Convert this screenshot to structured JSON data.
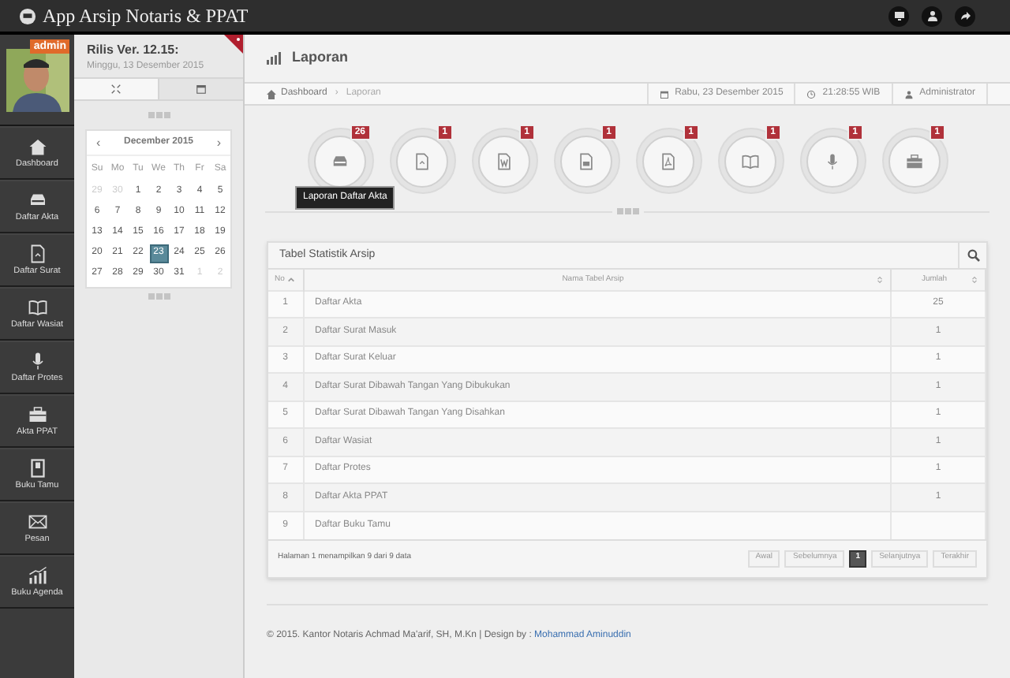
{
  "app_title": "App Arsip Notaris & PPAT",
  "profile": {
    "badge": "admin"
  },
  "nav": [
    {
      "label": "Dashboard"
    },
    {
      "label": "Daftar Akta"
    },
    {
      "label": "Daftar Surat"
    },
    {
      "label": "Daftar Wasiat"
    },
    {
      "label": "Daftar Protes"
    },
    {
      "label": "Akta PPAT"
    },
    {
      "label": "Buku Tamu"
    },
    {
      "label": "Pesan"
    },
    {
      "label": "Buku Agenda"
    }
  ],
  "release": {
    "title": "Rilis Ver. 12.15:",
    "date": "Minggu, 13 Desember 2015"
  },
  "panel_tabs": [
    {
      "selected": false
    },
    {
      "selected": true
    }
  ],
  "calendar": {
    "prev": "‹",
    "next": "›",
    "month": "December 2015",
    "weekdays": [
      "Su",
      "Mo",
      "Tu",
      "We",
      "Th",
      "Fr",
      "Sa"
    ],
    "days": [
      {
        "d": "29",
        "muted": true,
        "selected": false
      },
      {
        "d": "30",
        "muted": true,
        "selected": false
      },
      {
        "d": "1",
        "muted": false,
        "selected": false
      },
      {
        "d": "2",
        "muted": false,
        "selected": false
      },
      {
        "d": "3",
        "muted": false,
        "selected": false
      },
      {
        "d": "4",
        "muted": false,
        "selected": false
      },
      {
        "d": "5",
        "muted": false,
        "selected": false
      },
      {
        "d": "6",
        "muted": false,
        "selected": false
      },
      {
        "d": "7",
        "muted": false,
        "selected": false
      },
      {
        "d": "8",
        "muted": false,
        "selected": false
      },
      {
        "d": "9",
        "muted": false,
        "selected": false
      },
      {
        "d": "10",
        "muted": false,
        "selected": false
      },
      {
        "d": "11",
        "muted": false,
        "selected": false
      },
      {
        "d": "12",
        "muted": false,
        "selected": false
      },
      {
        "d": "13",
        "muted": false,
        "selected": false
      },
      {
        "d": "14",
        "muted": false,
        "selected": false
      },
      {
        "d": "15",
        "muted": false,
        "selected": false
      },
      {
        "d": "16",
        "muted": false,
        "selected": false
      },
      {
        "d": "17",
        "muted": false,
        "selected": false
      },
      {
        "d": "18",
        "muted": false,
        "selected": false
      },
      {
        "d": "19",
        "muted": false,
        "selected": false
      },
      {
        "d": "20",
        "muted": false,
        "selected": false
      },
      {
        "d": "21",
        "muted": false,
        "selected": false
      },
      {
        "d": "22",
        "muted": false,
        "selected": false
      },
      {
        "d": "23",
        "muted": false,
        "selected": true
      },
      {
        "d": "24",
        "muted": false,
        "selected": false
      },
      {
        "d": "25",
        "muted": false,
        "selected": false
      },
      {
        "d": "26",
        "muted": false,
        "selected": false
      },
      {
        "d": "27",
        "muted": false,
        "selected": false
      },
      {
        "d": "28",
        "muted": false,
        "selected": false
      },
      {
        "d": "29",
        "muted": false,
        "selected": false
      },
      {
        "d": "30",
        "muted": false,
        "selected": false
      },
      {
        "d": "31",
        "muted": false,
        "selected": false
      },
      {
        "d": "1",
        "muted": true,
        "selected": false
      },
      {
        "d": "2",
        "muted": true,
        "selected": false
      }
    ]
  },
  "page_title": "Laporan",
  "breadcrumb": [
    "Dashboard",
    "Laporan"
  ],
  "breadcrumb_separator": "›",
  "info_bar": [
    "Rabu, 23 Desember 2015",
    "21:28:55 WIB",
    "Administrator"
  ],
  "shortcuts": [
    {
      "count": "26"
    },
    {
      "count": "1"
    },
    {
      "count": "1"
    },
    {
      "count": "1"
    },
    {
      "count": "1"
    },
    {
      "count": "1"
    },
    {
      "count": "1"
    },
    {
      "count": "1"
    }
  ],
  "tooltip": "Laporan Daftar Akta",
  "table": {
    "title": "Tabel Statistik Arsip",
    "columns": [
      "No",
      "Nama Tabel Arsip",
      "Jumlah"
    ],
    "rows": [
      [
        "1",
        "Daftar Akta",
        "25"
      ],
      [
        "2",
        "Daftar Surat Masuk",
        "1"
      ],
      [
        "3",
        "Daftar Surat Keluar",
        "1"
      ],
      [
        "4",
        "Daftar Surat Dibawah Tangan Yang Dibukukan",
        "1"
      ],
      [
        "5",
        "Daftar Surat Dibawah Tangan Yang Disahkan",
        "1"
      ],
      [
        "6",
        "Daftar Wasiat",
        "1"
      ],
      [
        "7",
        "Daftar Protes",
        "1"
      ],
      [
        "8",
        "Daftar Akta PPAT",
        "1"
      ],
      [
        "9",
        "Daftar Buku Tamu",
        null
      ]
    ],
    "info": "Halaman 1 menampilkan 9 dari 9 data",
    "pager": [
      {
        "label": "Awal",
        "disabled": true,
        "selected": false
      },
      {
        "label": "Sebelumnya",
        "disabled": true,
        "selected": false
      },
      {
        "label": "1",
        "disabled": false,
        "selected": true
      },
      {
        "label": "Selanjutnya",
        "disabled": true,
        "selected": false
      },
      {
        "label": "Terakhir",
        "disabled": true,
        "selected": false
      }
    ]
  },
  "footer": {
    "text": "© 2015. Kantor Notaris Achmad Ma'arif, SH, M.Kn | Design by : ",
    "link": "Mohammad Aminuddin"
  }
}
